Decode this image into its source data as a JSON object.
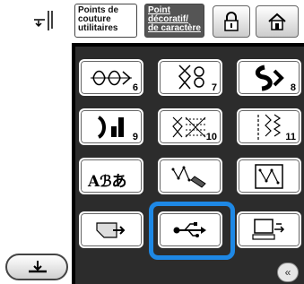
{
  "tabs": {
    "utility_label_lines": [
      "Points de",
      "couture",
      "utilitaires"
    ],
    "decorative_label_lines": [
      "Point",
      "décoratif/",
      "de caractère"
    ]
  },
  "stitch_buttons": [
    {
      "name": "stitch-category-6",
      "number": "6"
    },
    {
      "name": "stitch-category-7",
      "number": "7"
    },
    {
      "name": "stitch-category-8",
      "number": "8"
    },
    {
      "name": "stitch-category-9",
      "number": "9"
    },
    {
      "name": "stitch-category-10",
      "number": "10"
    },
    {
      "name": "stitch-category-11",
      "number": "11"
    }
  ],
  "char_button": {
    "text": "Aℬあ"
  },
  "icons": {
    "needle": "needle-position-icon",
    "lock": "lock-icon",
    "home": "home-icon",
    "presser_foot": "presser-foot-icon",
    "usb": "usb-icon",
    "scroll_up": "«"
  },
  "colors": {
    "highlight": "#1e88e5",
    "panel": "#2c2c2c",
    "active_tab": "#555555"
  }
}
